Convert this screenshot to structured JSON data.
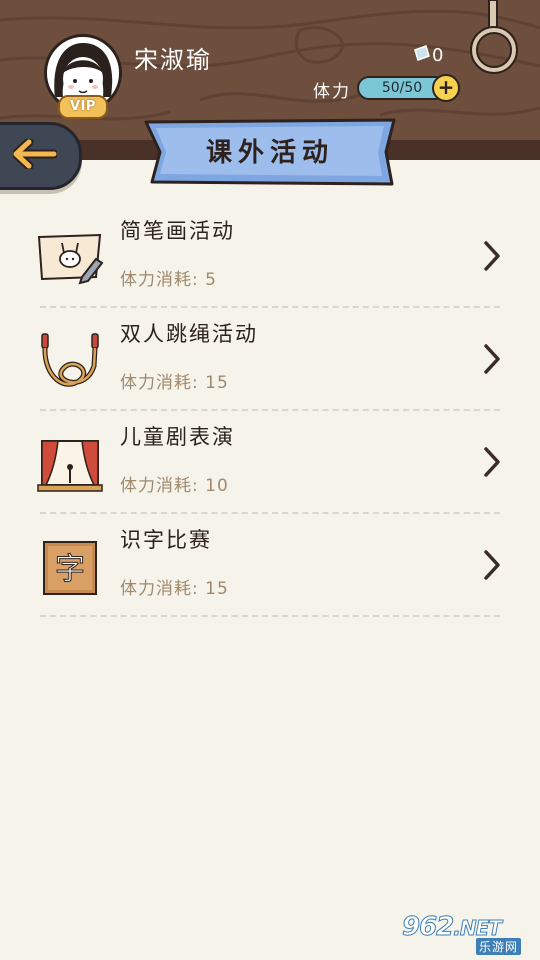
{
  "header": {
    "player_name": "宋淑瑜",
    "vip_label": "VIP",
    "ticket_count": "0",
    "stamina_label": "体力",
    "stamina_value": "50/50",
    "stamina_add": "+"
  },
  "page": {
    "title": "课外活动"
  },
  "activities": [
    {
      "title": "简笔画活动",
      "cost": "体力消耗: 5",
      "icon": "drawing-board-icon"
    },
    {
      "title": "双人跳绳活动",
      "cost": "体力消耗: 15",
      "icon": "jump-rope-icon"
    },
    {
      "title": "儿童剧表演",
      "cost": "体力消耗: 10",
      "icon": "stage-curtain-icon"
    },
    {
      "title": "识字比赛",
      "cost": "体力消耗: 15",
      "icon": "character-block-icon"
    }
  ],
  "icon_glyphs": {
    "character": "字"
  },
  "watermark": {
    "main": "962",
    "suffix": ".NET",
    "sub": "乐游网"
  },
  "colors": {
    "wood": "#6e4f3d",
    "background": "#f6f3ea",
    "banner": "#7ea6e0",
    "stamina_bar": "#7cc7d6",
    "vip": "#f3c15a",
    "cost_text": "#a08a6e"
  }
}
